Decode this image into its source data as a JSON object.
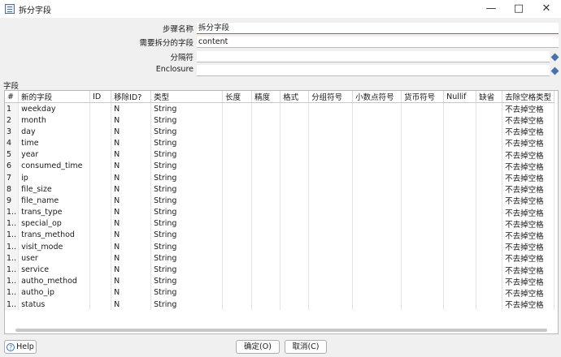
{
  "window": {
    "title": "拆分字段",
    "minimize_glyph": "—",
    "maximize_glyph": "□",
    "close_glyph": "✕"
  },
  "form": {
    "step_name_label": "步骤名称",
    "step_name_value": "拆分字段",
    "split_field_label": "需要拆分的字段",
    "split_field_value": "content",
    "delimiter_label": "分隔符",
    "delimiter_value": "",
    "enclosure_label": "Enclosure",
    "enclosure_value": ""
  },
  "fields_section_label": "字段",
  "table": {
    "headers": [
      "#",
      "新的字段",
      "ID",
      "移除ID?",
      "类型",
      "长度",
      "精度",
      "格式",
      "分组符号",
      "小数点符号",
      "货币符号",
      "Nullif",
      "缺省",
      "去除空格类型"
    ],
    "rows": [
      [
        "1",
        "weekday",
        "",
        "N",
        "String",
        "",
        "",
        "",
        "",
        "",
        "",
        "",
        "",
        "不去掉空格"
      ],
      [
        "2",
        "month",
        "",
        "N",
        "String",
        "",
        "",
        "",
        "",
        "",
        "",
        "",
        "",
        "不去掉空格"
      ],
      [
        "3",
        "day",
        "",
        "N",
        "String",
        "",
        "",
        "",
        "",
        "",
        "",
        "",
        "",
        "不去掉空格"
      ],
      [
        "4",
        "time",
        "",
        "N",
        "String",
        "",
        "",
        "",
        "",
        "",
        "",
        "",
        "",
        "不去掉空格"
      ],
      [
        "5",
        "year",
        "",
        "N",
        "String",
        "",
        "",
        "",
        "",
        "",
        "",
        "",
        "",
        "不去掉空格"
      ],
      [
        "6",
        "consumed_time",
        "",
        "N",
        "String",
        "",
        "",
        "",
        "",
        "",
        "",
        "",
        "",
        "不去掉空格"
      ],
      [
        "7",
        "ip",
        "",
        "N",
        "String",
        "",
        "",
        "",
        "",
        "",
        "",
        "",
        "",
        "不去掉空格"
      ],
      [
        "8",
        "file_size",
        "",
        "N",
        "String",
        "",
        "",
        "",
        "",
        "",
        "",
        "",
        "",
        "不去掉空格"
      ],
      [
        "9",
        "file_name",
        "",
        "N",
        "String",
        "",
        "",
        "",
        "",
        "",
        "",
        "",
        "",
        "不去掉空格"
      ],
      [
        "1..",
        "trans_type",
        "",
        "N",
        "String",
        "",
        "",
        "",
        "",
        "",
        "",
        "",
        "",
        "不去掉空格"
      ],
      [
        "1..",
        "special_op",
        "",
        "N",
        "String",
        "",
        "",
        "",
        "",
        "",
        "",
        "",
        "",
        "不去掉空格"
      ],
      [
        "1..",
        "trans_method",
        "",
        "N",
        "String",
        "",
        "",
        "",
        "",
        "",
        "",
        "",
        "",
        "不去掉空格"
      ],
      [
        "1..",
        "visit_mode",
        "",
        "N",
        "String",
        "",
        "",
        "",
        "",
        "",
        "",
        "",
        "",
        "不去掉空格"
      ],
      [
        "1..",
        "user",
        "",
        "N",
        "String",
        "",
        "",
        "",
        "",
        "",
        "",
        "",
        "",
        "不去掉空格"
      ],
      [
        "1..",
        "service",
        "",
        "N",
        "String",
        "",
        "",
        "",
        "",
        "",
        "",
        "",
        "",
        "不去掉空格"
      ],
      [
        "1..",
        "autho_method",
        "",
        "N",
        "String",
        "",
        "",
        "",
        "",
        "",
        "",
        "",
        "",
        "不去掉空格"
      ],
      [
        "1..",
        "autho_ip",
        "",
        "N",
        "String",
        "",
        "",
        "",
        "",
        "",
        "",
        "",
        "",
        "不去掉空格"
      ],
      [
        "1..",
        "status",
        "",
        "N",
        "String",
        "",
        "",
        "",
        "",
        "",
        "",
        "",
        "",
        "不去掉空格"
      ]
    ]
  },
  "buttons": {
    "help": "Help",
    "help_icon": "?",
    "ok": "确定(O)",
    "cancel": "取消(C)"
  }
}
